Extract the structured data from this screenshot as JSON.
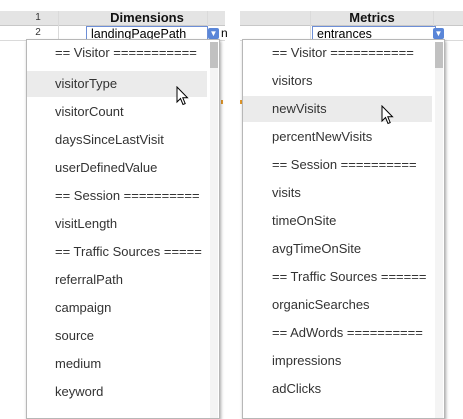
{
  "left_panel": {
    "row_numbers": [
      "1",
      "2"
    ],
    "column_header": "Dimensions",
    "cell_value": "landingPagePath",
    "cell_overflow": "n",
    "dropdown_options": [
      "== Visitor ===========",
      "visitorType",
      "visitorCount",
      "daysSinceLastVisit",
      "userDefinedValue",
      "== Session ==========",
      "visitLength",
      "== Traffic Sources =====",
      "referralPath",
      "campaign",
      "source",
      "medium",
      "keyword"
    ],
    "highlighted_option": "visitorType"
  },
  "right_panel": {
    "column_header": "Metrics",
    "cell_value": "entrances",
    "dropdown_options": [
      "== Visitor ===========",
      "visitors",
      "newVisits",
      "percentNewVisits",
      "== Session ==========",
      "visits",
      "timeOnSite",
      "avgTimeOnSite",
      "== Traffic Sources ======",
      "organicSearches",
      "== AdWords ==========",
      "impressions",
      "adClicks"
    ],
    "highlighted_option": "newVisits"
  },
  "icons": {
    "dropdown_arrow": "chevron-down-icon",
    "cursor": "mouse-pointer-icon"
  },
  "colors": {
    "header_bg": "#e4e4e4",
    "highlight_bg": "#ebebeb",
    "active_cell_border": "#6d8ed6",
    "dropdown_button": "#5a86d8"
  }
}
